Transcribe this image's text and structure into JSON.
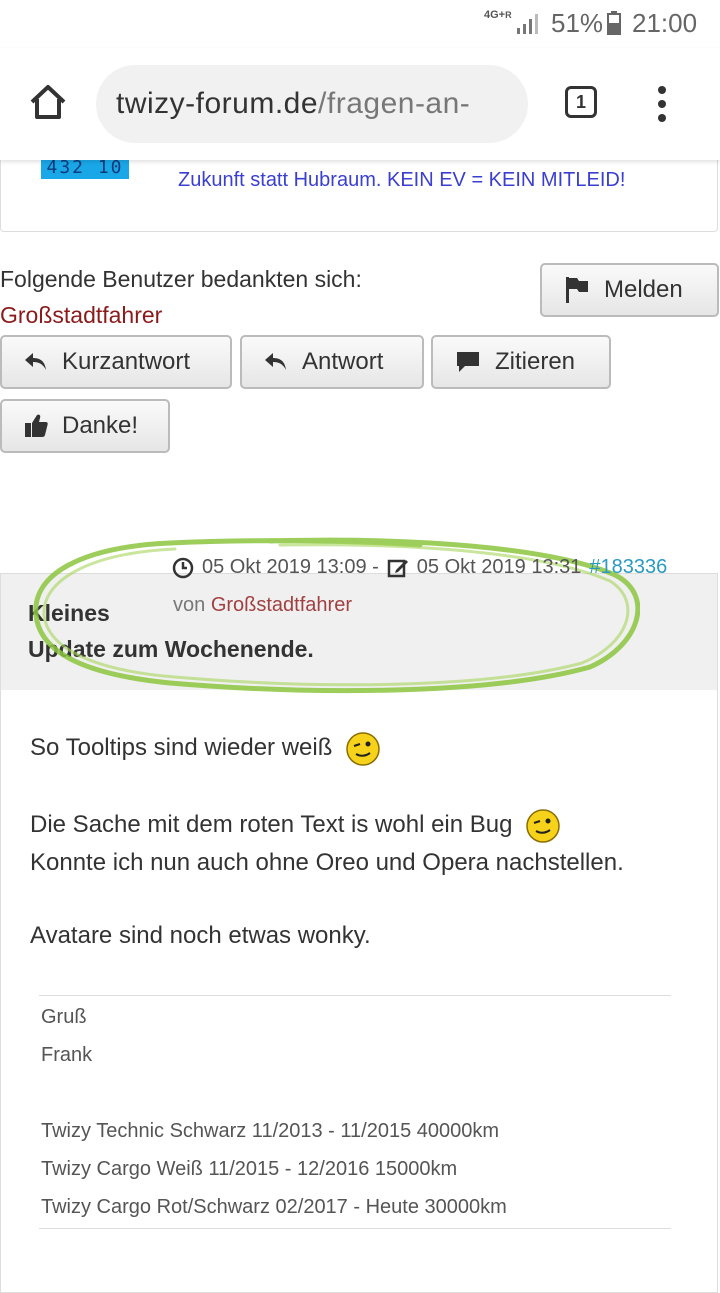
{
  "status_bar": {
    "network": "4G+",
    "roaming": "R",
    "battery_percent": "51%",
    "time": "21:00"
  },
  "browser": {
    "url_domain": "twizy-forum.de",
    "url_path": "/fragen-an-",
    "tab_count": "1"
  },
  "signature_box": {
    "lcd_digits": "432 10",
    "slogan": "Zukunft statt Hubraum. KEIN EV = KEIN MITLEID!"
  },
  "thanks": {
    "label": "Folgende Benutzer bedankten sich:",
    "user": "Großstadtfahrer"
  },
  "buttons": {
    "report": "Melden",
    "quick_reply": "Kurzantwort",
    "reply": "Antwort",
    "quote": "Zitieren",
    "thanks": "Danke!"
  },
  "post": {
    "created": "05 Okt 2019 13:09 -",
    "edited": "05 Okt 2019 13:31",
    "post_link": "#183336",
    "title_line1": "Kleines",
    "title_line2": "Update zum Wochenende.",
    "author_prefix": "von",
    "author": "Großstadtfahrer",
    "paragraphs": {
      "p1": "So Tooltips sind wieder weiß",
      "p2a": "Die Sache mit dem roten Text is wohl ein Bug",
      "p2b": "Konnte ich nun auch ohne Oreo und Opera nachstellen.",
      "p3": "Avatare sind noch etwas wonky."
    },
    "signature": {
      "greeting": "Gruß",
      "name": "Frank",
      "line1": "Twizy Technic Schwarz 11/2013 - 11/2015 40000km",
      "line2": "Twizy Cargo Weiß 11/2015 - 12/2016 15000km",
      "line3": "Twizy Cargo Rot/Schwarz 02/2017 - Heute 30000km"
    }
  },
  "colors": {
    "thanks_user": "#8b1a1a",
    "slogan": "#3a3fd0",
    "post_link": "#2a9ac0",
    "highlight_marker": "#8cc63f"
  }
}
